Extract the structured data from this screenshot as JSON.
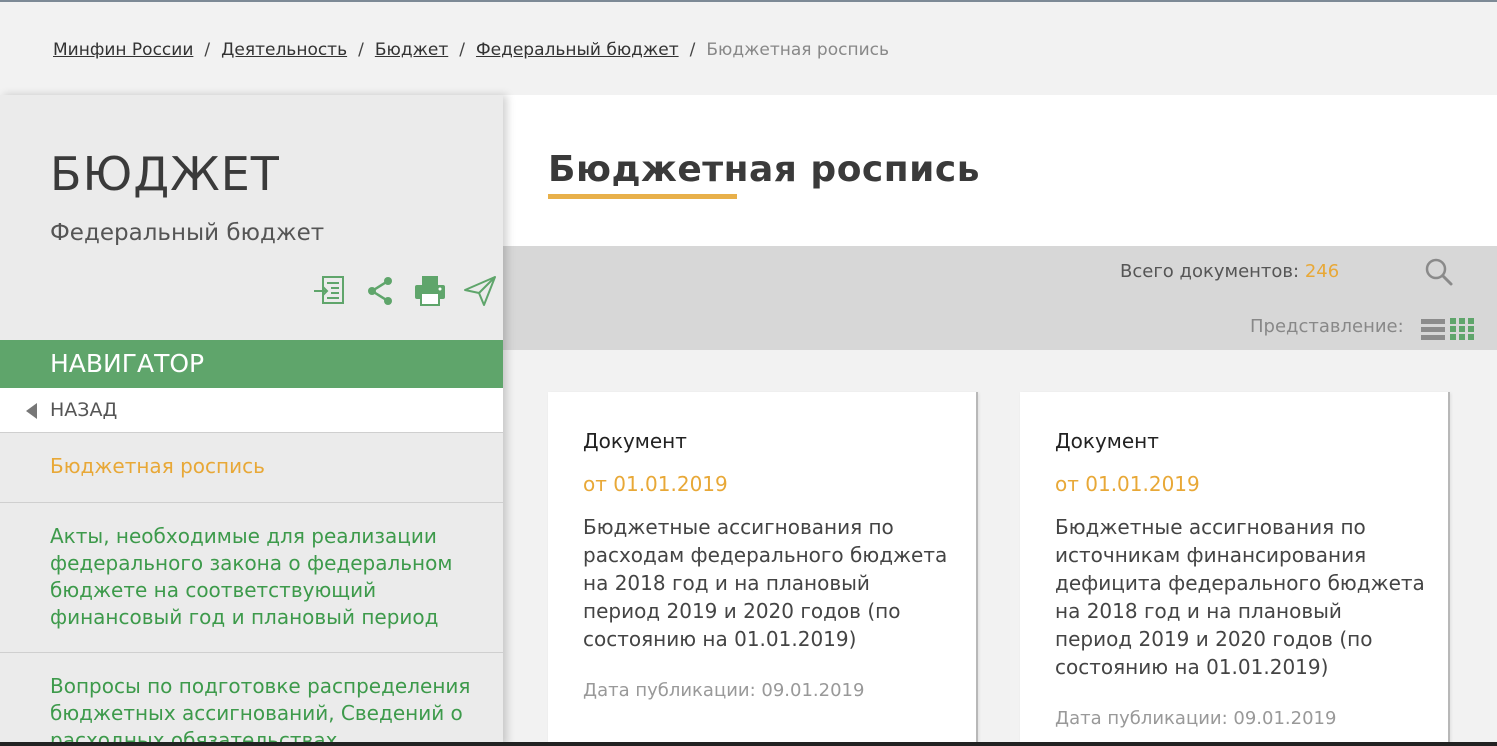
{
  "breadcrumb": {
    "items": [
      "Минфин России",
      "Деятельность",
      "Бюджет",
      "Федеральный бюджет"
    ],
    "separator": "/",
    "current": "Бюджетная роспись"
  },
  "sidebar": {
    "title": "БЮДЖЕТ",
    "subtitle": "Федеральный бюджет",
    "icons": [
      "export-icon",
      "share-icon",
      "print-icon",
      "send-icon"
    ],
    "navigator_label": "НАВИГАТОР",
    "back_label": "НАЗАД",
    "items": [
      {
        "label": "Бюджетная роспись",
        "active": true
      },
      {
        "label": "Акты, необходимые для реализации федерального закона о федеральном бюджете на соответствующий финансовый год и плановый период",
        "active": false
      },
      {
        "label": "Вопросы по подготовке распределения бюджетных ассигнований, Сведений о расходных обязательствах, обоснований",
        "active": false
      }
    ]
  },
  "main": {
    "title": "Бюджетная роспись",
    "total_label": "Всего документов:",
    "total_count": "246",
    "view_label": "Представление:"
  },
  "cards": [
    {
      "type": "Документ",
      "date": "от 01.01.2019",
      "description": "Бюджетные ассигнования по расходам федерального бюджета на 2018 год и на плановый период 2019 и 2020 годов (по состоянию на 01.01.2019)",
      "published": "Дата публикации: 09.01.2019"
    },
    {
      "type": "Документ",
      "date": "от 01.01.2019",
      "description": "Бюджетные ассигнования по источникам финансирования дефицита федерального бюджета на 2018 год и на плановый период 2019 и 2020 годов (по состоянию на 01.01.2019)",
      "published": "Дата публикации: 09.01.2019"
    }
  ],
  "colors": {
    "accent_green": "#5fa56b",
    "link_green": "#3d9a4b",
    "accent_orange": "#e8a837"
  }
}
